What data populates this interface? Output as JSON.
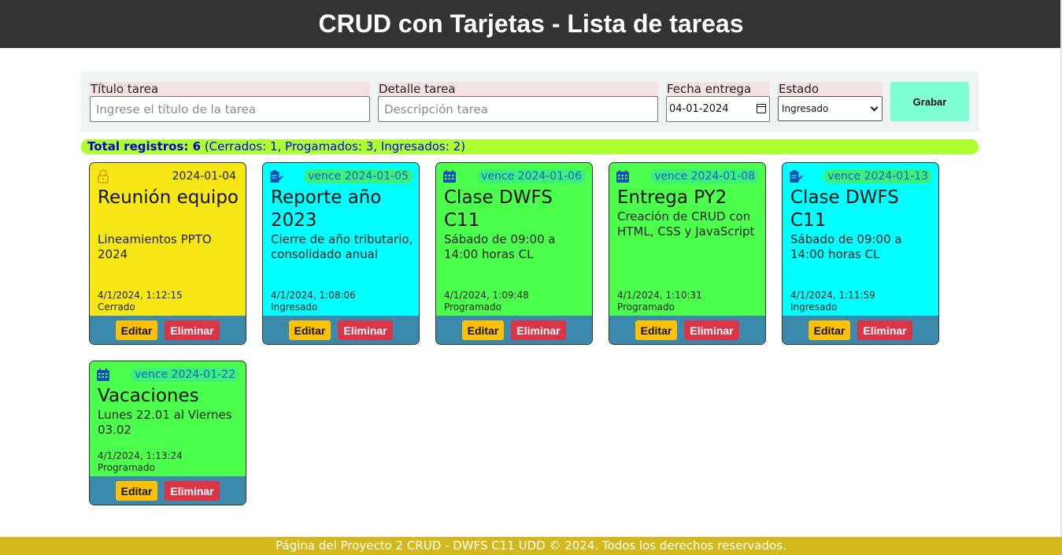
{
  "header": {
    "title": "CRUD con Tarjetas - Lista de tareas"
  },
  "form": {
    "title_label": "Título tarea",
    "title_placeholder": "Ingrese el título de la tarea",
    "detail_label": "Detalle tarea",
    "detail_placeholder": "Descripción tarea",
    "date_label": "Fecha entrega",
    "date_value": "04-01-2024",
    "status_label": "Estado",
    "status_value": "Ingresado",
    "save_label": "Grabar"
  },
  "summary": {
    "total_label": "Total registros: 6",
    "breakdown": "(Cerrados: 1, Progamados: 3, Ingresados: 2)"
  },
  "colors": {
    "cerrado": "#f8e716",
    "ingresado": "#00ffff",
    "programado": "#4cff4c",
    "card_bar": "#3c89ae",
    "edit": "#ffc107",
    "delete": "#dc3545"
  },
  "cards": [
    {
      "icon": "lock-icon",
      "date": "2024-01-04",
      "title": "Reunión equipo",
      "detail": "Lineamientos PPTO 2024",
      "timestamp": "4/1/2024, 1:12:15",
      "status": "Cerrado",
      "edit_label": "Editar",
      "delete_label": "Eliminar"
    },
    {
      "icon": "clipboard-edit-icon",
      "due": "vence 2024-01-05",
      "title": "Reporte año 2023",
      "detail": "Cierre de año tributario, consolidado anual",
      "timestamp": "4/1/2024, 1:08:06",
      "status": "Ingresado",
      "edit_label": "Editar",
      "delete_label": "Eliminar"
    },
    {
      "icon": "calendar-icon",
      "due": "vence 2024-01-06",
      "title": "Clase DWFS C11",
      "detail": "Sábado de 09:00 a 14:00 horas CL",
      "timestamp": "4/1/2024, 1:09:48",
      "status": "Programado",
      "edit_label": "Editar",
      "delete_label": "Eliminar"
    },
    {
      "icon": "calendar-icon",
      "due": "vence 2024-01-08",
      "title": "Entrega PY2",
      "detail": "Creación de CRUD con HTML, CSS y JavaScript",
      "timestamp": "4/1/2024, 1:10:31",
      "status": "Programado",
      "edit_label": "Editar",
      "delete_label": "Eliminar"
    },
    {
      "icon": "clipboard-edit-icon",
      "due": "vence 2024-01-13",
      "title": "Clase DWFS C11",
      "detail": "Sábado de 09:00 a 14:00 horas CL",
      "timestamp": "4/1/2024, 1:11:59",
      "status": "Ingresado",
      "edit_label": "Editar",
      "delete_label": "Eliminar"
    },
    {
      "icon": "calendar-icon",
      "due": "vence 2024-01-22",
      "title": "Vacaciones",
      "detail": "Lunes 22.01 al Viernes 03.02",
      "timestamp": "4/1/2024, 1:13:24",
      "status": "Programado",
      "edit_label": "Editar",
      "delete_label": "Eliminar"
    }
  ],
  "footer": {
    "text": "Página del Proyecto 2 CRUD - DWFS C11 UDD © 2024. Todos los derechos reservados."
  }
}
